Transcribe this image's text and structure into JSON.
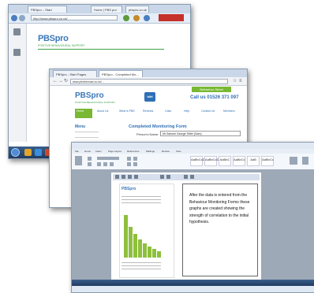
{
  "shot1": {
    "tabs": [
      "PBSpro – Start",
      "Home | PBS pro",
      "pbspro.co.uk"
    ],
    "url": "http://www.pbspro.co.uk/",
    "logo": "PBSpro",
    "logo_sub": "POSITIVE BEHAVIOURAL SUPPORT"
  },
  "shot2": {
    "tabs": [
      "PBSpro - Start Pages",
      "PBSpro - Completed Mo..."
    ],
    "url": "www.pbsthechart.co.uk/...",
    "green_button": "Behaviour Sheet",
    "logo": "PBSpro",
    "logo_sub": "POSITIVE BEHAVIOURAL SUPPORT",
    "bild": "bild",
    "call_text": "Call us",
    "phone": "01526 371 097",
    "nav": [
      "Home",
      "About Us",
      "What is PBS",
      "Reviews",
      "Links",
      "Help",
      "Contact Us",
      "Members"
    ],
    "side_heading": "Menu",
    "form_title": "Completed Monitoring Form",
    "person_label": "Person's Name:",
    "person_value": "Mr Samuel George Telfer (Sam)"
  },
  "shot3": {
    "ribbon_tabs": [
      "File",
      "Home",
      "Insert",
      "Page Layout",
      "References",
      "Mailings",
      "Review",
      "View"
    ],
    "styles": [
      "AaBbCcDd",
      "AaBbCcDd",
      "AaBbC",
      "AaBbCc",
      "AaB",
      "AaBbCc"
    ],
    "mini_logo": "PBSpro",
    "callout_text": "After the data is entered from the Behaviour Monitoring Forms these graphs are created showing the strength of correlation to the initial hypothesis.",
    "bar_values": [
      1.0,
      0.72,
      0.55,
      0.42,
      0.33,
      0.26,
      0.2,
      0.15
    ]
  },
  "colors": {
    "brand_blue": "#3a78b8",
    "brand_green": "#78b833",
    "taskbar": "#1f3b60",
    "bar_green": "#8dc03c"
  }
}
